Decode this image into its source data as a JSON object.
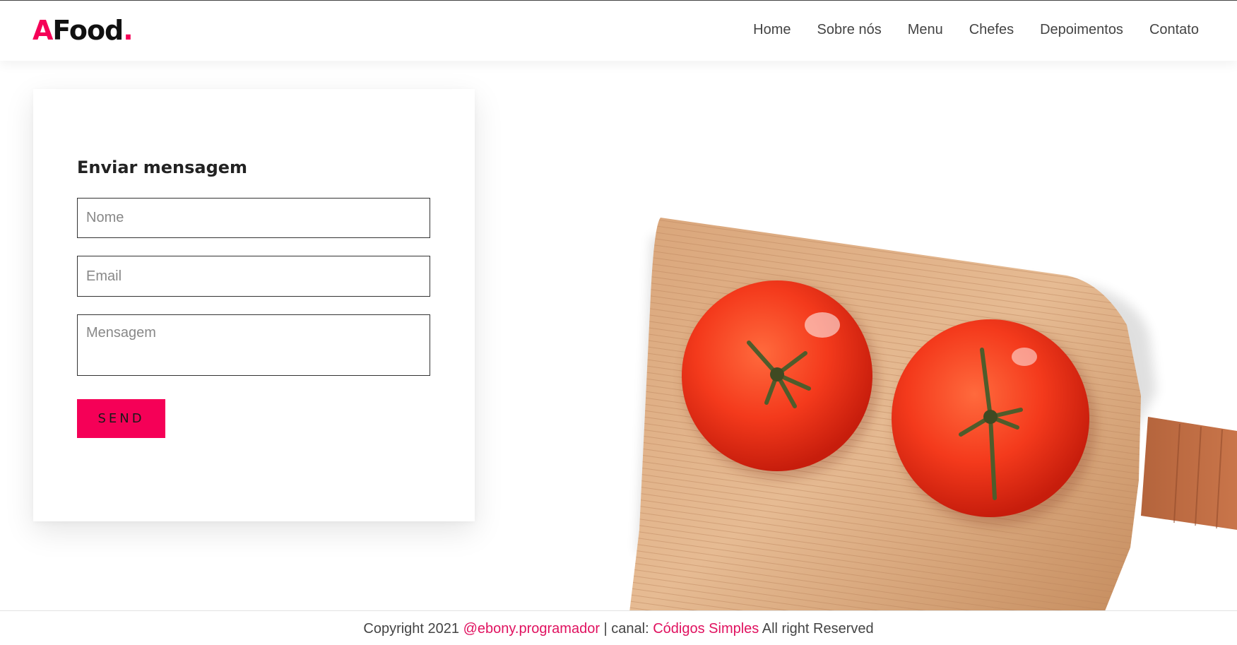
{
  "brand": {
    "logo_first": "A",
    "logo_rest": "Food",
    "logo_dot": ".",
    "accent_color": "#f50057"
  },
  "nav": {
    "items": [
      {
        "label": "Home"
      },
      {
        "label": "Sobre nós"
      },
      {
        "label": "Menu"
      },
      {
        "label": "Chefes"
      },
      {
        "label": "Depoimentos"
      },
      {
        "label": "Contato"
      }
    ]
  },
  "contact_form": {
    "title": "Enviar mensagem",
    "name_placeholder": "Nome",
    "email_placeholder": "Email",
    "message_placeholder": "Mensagem",
    "send_label": "SEND"
  },
  "footer": {
    "prefix": "Copyright 2021",
    "instagram": "@ebony.programador",
    "separator": "| canal:",
    "channel": "Códigos Simples",
    "suffix": "All right Reserved"
  }
}
